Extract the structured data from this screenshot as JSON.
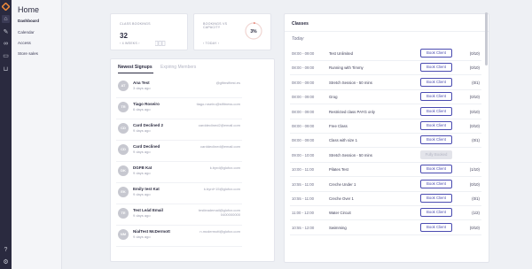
{
  "menu": {
    "title": "Home",
    "items": [
      {
        "label": "Dashboard",
        "active": true
      },
      {
        "label": "Calendar",
        "active": false
      },
      {
        "label": "Access",
        "active": false
      },
      {
        "label": "Store sales",
        "active": false
      }
    ]
  },
  "stats": {
    "class_bookings": {
      "label": "Class bookings",
      "value": "32",
      "nav": "4 weeks"
    },
    "capacity": {
      "label": "Bookings vs capacity",
      "value": "3%",
      "percent": 3,
      "nav": "today"
    }
  },
  "signups": {
    "tabs": [
      "Newest Signups",
      "Expiring Members"
    ],
    "rows": [
      {
        "initials": "AT",
        "name": "Ana Test",
        "ago": "3 days ago",
        "email": "@gfitnsfitest.es",
        "phone": ""
      },
      {
        "initials": "TR",
        "name": "Tiago Roseiro",
        "ago": "6 days ago",
        "email": "tiago.roseiro@stfitness.com",
        "phone": ""
      },
      {
        "initials": "CD",
        "name": "Card Declined 2",
        "ago": "9 days ago",
        "email": "carddeclined2@email.com",
        "phone": ""
      },
      {
        "initials": "CD",
        "name": "Card Declined",
        "ago": "9 days ago",
        "email": "carddeclined@email.com",
        "phone": ""
      },
      {
        "initials": "DK",
        "name": "DGFB Kat",
        "ago": "9 days ago",
        "email": "k.byrd@glofox.com",
        "phone": ""
      },
      {
        "initials": "EK",
        "name": "Emily test Kat",
        "ago": "9 days ago",
        "email": "k.byrd+15@glofox.com",
        "phone": ""
      },
      {
        "initials": "TE",
        "name": "Test Leád Email",
        "ago": "9 days ago",
        "email": "testleademail@glofox.com",
        "phone": "0400000000"
      },
      {
        "initials": "NM",
        "name": "NialTest McDermott",
        "ago": "9 days ago",
        "email": "n.mcdermott@glofox.com",
        "phone": ""
      }
    ]
  },
  "classes": {
    "title": "Classes",
    "day": "Today",
    "book_label": "Book Client",
    "full_label": "Fully Booked",
    "rows": [
      {
        "time": "08:00 - 09:00",
        "name": "Test Unlimited",
        "cap": "(0/10)",
        "full": false
      },
      {
        "time": "08:00 - 09:00",
        "name": "Running with Timmy",
        "cap": "(0/10)",
        "full": false
      },
      {
        "time": "08:00 - 09:00",
        "name": "Stretch Session - 50 mins",
        "cap": "(0/1)",
        "full": false
      },
      {
        "time": "08:00 - 09:00",
        "name": "Grog",
        "cap": "(0/10)",
        "full": false
      },
      {
        "time": "08:00 - 09:00",
        "name": "Restricted class PAYG only",
        "cap": "(0/10)",
        "full": false
      },
      {
        "time": "08:00 - 09:00",
        "name": "Free Class",
        "cap": "(0/10)",
        "full": false
      },
      {
        "time": "08:00 - 09:00",
        "name": "Class with size 1",
        "cap": "(0/1)",
        "full": false
      },
      {
        "time": "09:00 - 10:00",
        "name": "Stretch Session - 50 mins",
        "cap": "",
        "full": true
      },
      {
        "time": "10:00 - 11:00",
        "name": "Pilates Test",
        "cap": "(1/10)",
        "full": false
      },
      {
        "time": "10:55 - 11:00",
        "name": "Creche Under 1",
        "cap": "(0/10)",
        "full": false
      },
      {
        "time": "10:55 - 11:00",
        "name": "Creche Over 1",
        "cap": "(0/1)",
        "full": false
      },
      {
        "time": "11:00 - 12:00",
        "name": "Water Circuit",
        "cap": "(1/2)",
        "full": false
      },
      {
        "time": "10:55 - 12:00",
        "name": "Swimming",
        "cap": "(0/10)",
        "full": false
      }
    ]
  },
  "colors": {
    "accent": "#4a4bb0",
    "ring": "#e05a4a",
    "rail": "#2a2a3f"
  }
}
